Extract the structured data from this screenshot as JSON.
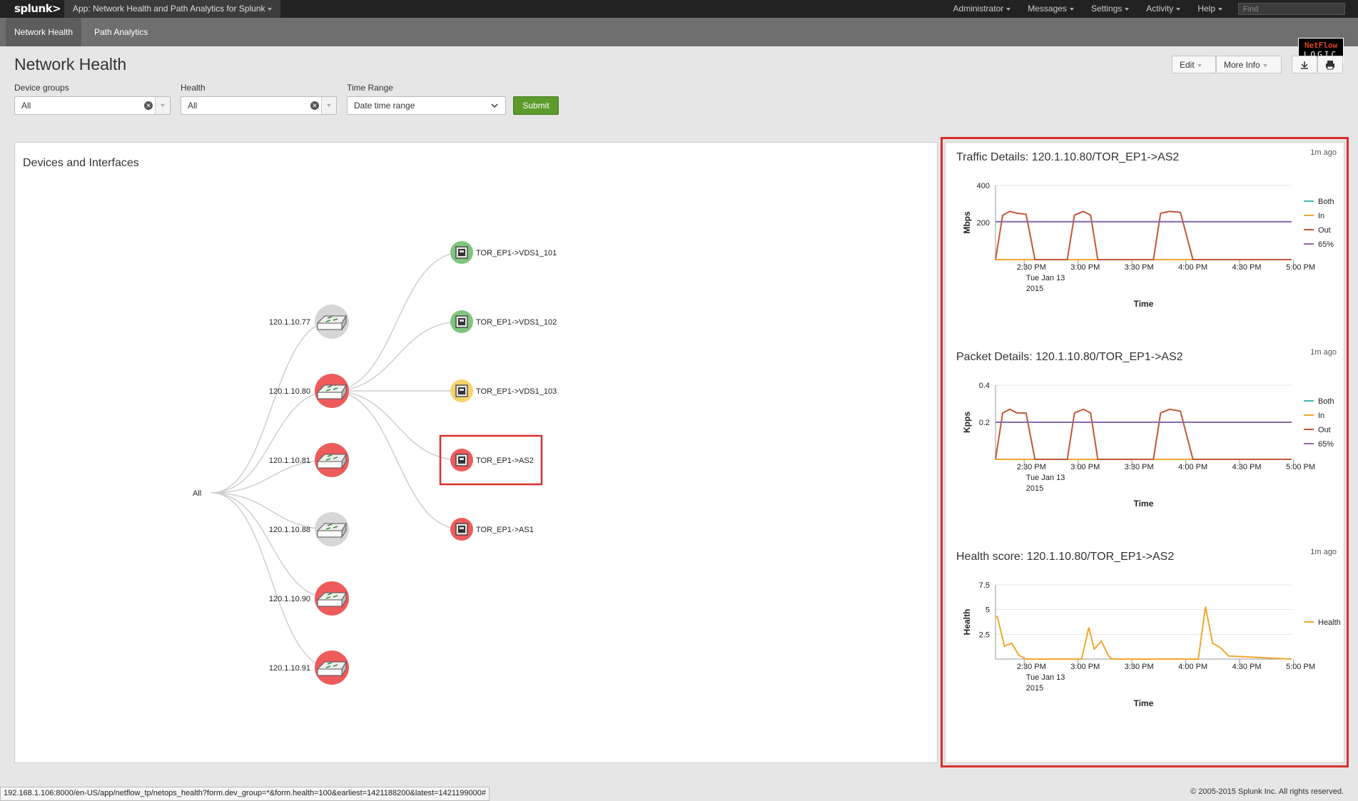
{
  "topbar": {
    "logo": "splunk>",
    "app_menu": "App: Network Health and Path Analytics for Splunk",
    "menus": [
      "Administrator",
      "Messages",
      "Settings",
      "Activity",
      "Help"
    ],
    "find_placeholder": "Find"
  },
  "appbar": {
    "tabs": [
      {
        "label": "Network Health",
        "active": true
      },
      {
        "label": "Path Analytics",
        "active": false
      }
    ],
    "brand_line1": "NetFlow",
    "brand_line2": "LOGIC"
  },
  "page": {
    "title": "Network Health",
    "edit_label": "Edit",
    "more_info_label": "More Info"
  },
  "filters": {
    "device_groups": {
      "label": "Device groups",
      "value": "All"
    },
    "health": {
      "label": "Health",
      "value": "All"
    },
    "time_range": {
      "label": "Time Range",
      "value": "Date time range"
    },
    "submit_label": "Submit"
  },
  "left_panel": {
    "title": "Devices and Interfaces",
    "root": "All",
    "devices": [
      {
        "label": "120.1.10.77",
        "status": "gray"
      },
      {
        "label": "120.1.10.80",
        "status": "red"
      },
      {
        "label": "120.1.10.81",
        "status": "red"
      },
      {
        "label": "120.1.10.88",
        "status": "gray"
      },
      {
        "label": "120.1.10.90",
        "status": "red"
      },
      {
        "label": "120.1.10.91",
        "status": "red"
      }
    ],
    "interfaces": [
      {
        "label": "TOR_EP1->VDS1_101",
        "status": "green"
      },
      {
        "label": "TOR_EP1->VDS1_102",
        "status": "green"
      },
      {
        "label": "TOR_EP1->VDS1_103",
        "status": "yellow"
      },
      {
        "label": "TOR_EP1->AS2",
        "status": "red",
        "selected": true
      },
      {
        "label": "TOR_EP1->AS1",
        "status": "red"
      }
    ],
    "colors": {
      "red": "#ee5b5b",
      "gray": "#d6d6d6",
      "green": "#7fc47f",
      "yellow": "#f7d36b"
    }
  },
  "charts": {
    "traffic": {
      "title": "Traffic Details: 120.1.10.80/TOR_EP1->AS2",
      "ago": "1m ago"
    },
    "packets": {
      "title": "Packet Details: 120.1.10.80/TOR_EP1->AS2",
      "ago": "1m ago"
    },
    "health": {
      "title": "Health score: 120.1.10.80/TOR_EP1->AS2",
      "ago": "1m ago"
    }
  },
  "chart_data": [
    {
      "type": "line",
      "title": "Traffic Details: 120.1.10.80/TOR_EP1->AS2",
      "xlabel": "Time",
      "ylabel": "Mbps",
      "xlim_minutes": [
        10,
        175
      ],
      "ylim": [
        0,
        400
      ],
      "yticks": [
        {
          "v": 200,
          "label": "200"
        },
        {
          "v": 400,
          "label": "400"
        }
      ],
      "xtick_labels": [
        "2:30 PM",
        "3:00 PM",
        "3:30 PM",
        "4:00 PM",
        "4:30 PM",
        "5:00 PM"
      ],
      "xtick_minutes": [
        30,
        60,
        90,
        120,
        150,
        180
      ],
      "xtick_sublabel": [
        "Tue Jan 13",
        "2015"
      ],
      "series": [
        {
          "name": "Both",
          "color": "#4bb4aa",
          "x": [],
          "y": []
        },
        {
          "name": "In",
          "color": "#f0a830",
          "x": [
            10,
            175
          ],
          "y": [
            0,
            0
          ]
        },
        {
          "name": "Out",
          "color": "#c0583a",
          "x": [
            10,
            14,
            18,
            22,
            27,
            32,
            50,
            54,
            59,
            63,
            67,
            83,
            98,
            102,
            107,
            113,
            120,
            175
          ],
          "y": [
            0,
            240,
            260,
            250,
            245,
            0,
            0,
            240,
            260,
            240,
            0,
            0,
            0,
            250,
            260,
            255,
            0,
            0
          ]
        },
        {
          "name": "65%",
          "color": "#8a6aa8",
          "x": [
            10,
            175
          ],
          "y": [
            205,
            205
          ]
        }
      ],
      "legend": "right"
    },
    {
      "type": "line",
      "title": "Packet Details: 120.1.10.80/TOR_EP1->AS2",
      "xlabel": "Time",
      "ylabel": "Kpps",
      "xlim_minutes": [
        10,
        175
      ],
      "ylim": [
        0,
        0.4
      ],
      "yticks": [
        {
          "v": 0.2,
          "label": "0.2"
        },
        {
          "v": 0.4,
          "label": "0.4"
        }
      ],
      "xtick_labels": [
        "2:30 PM",
        "3:00 PM",
        "3:30 PM",
        "4:00 PM",
        "4:30 PM",
        "5:00 PM"
      ],
      "xtick_minutes": [
        30,
        60,
        90,
        120,
        150,
        180
      ],
      "xtick_sublabel": [
        "Tue Jan 13",
        "2015"
      ],
      "series": [
        {
          "name": "Both",
          "color": "#4bb4aa",
          "x": [],
          "y": []
        },
        {
          "name": "In",
          "color": "#f0a830",
          "x": [
            10,
            175
          ],
          "y": [
            0,
            0
          ]
        },
        {
          "name": "Out",
          "color": "#c0583a",
          "x": [
            10,
            14,
            18,
            22,
            27,
            32,
            50,
            54,
            59,
            63,
            67,
            83,
            98,
            102,
            107,
            113,
            120,
            175
          ],
          "y": [
            0,
            0.25,
            0.27,
            0.25,
            0.25,
            0,
            0,
            0.25,
            0.27,
            0.25,
            0,
            0,
            0,
            0.25,
            0.27,
            0.26,
            0,
            0
          ]
        },
        {
          "name": "65%",
          "color": "#8a6aa8",
          "x": [
            10,
            175
          ],
          "y": [
            0.2,
            0.2
          ]
        }
      ],
      "legend": "right"
    },
    {
      "type": "line",
      "title": "Health score: 120.1.10.80/TOR_EP1->AS2",
      "xlabel": "Time",
      "ylabel": "Health",
      "xlim_minutes": [
        10,
        175
      ],
      "ylim": [
        0,
        7.5
      ],
      "yticks": [
        {
          "v": 2.5,
          "label": "2.5"
        },
        {
          "v": 5,
          "label": "5"
        },
        {
          "v": 7.5,
          "label": "7.5"
        }
      ],
      "xtick_labels": [
        "2:30 PM",
        "3:00 PM",
        "3:30 PM",
        "4:00 PM",
        "4:30 PM",
        "5:00 PM"
      ],
      "xtick_minutes": [
        30,
        60,
        90,
        120,
        150,
        180
      ],
      "xtick_sublabel": [
        "Tue Jan 13",
        "2015"
      ],
      "series": [
        {
          "name": "Health",
          "color": "#f0a830",
          "x": [
            10,
            11,
            15,
            19,
            23,
            27,
            35,
            58,
            62,
            65,
            69,
            73,
            75,
            123,
            127,
            131,
            135,
            140,
            175
          ],
          "y": [
            4.2,
            4.3,
            1.3,
            1.6,
            0.4,
            0,
            0,
            0,
            3.2,
            1.0,
            1.8,
            0.3,
            0,
            0,
            5.3,
            1.6,
            1.2,
            0.3,
            0
          ]
        }
      ],
      "legend": "right"
    }
  ],
  "footer": {
    "status_url": "192.168.1.106:8000/en-US/app/netflow_tp/netops_health?form.dev_group=*&form.health=100&earliest=1421188200&latest=1421199000#",
    "copyright": "© 2005-2015 Splunk Inc. All rights reserved."
  }
}
